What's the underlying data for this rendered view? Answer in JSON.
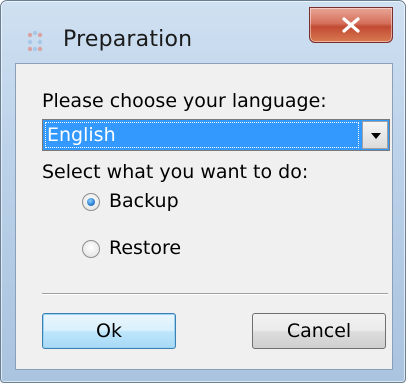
{
  "window": {
    "title": "Preparation",
    "close_icon": "close-icon",
    "app_icon": "app-recycle-icon"
  },
  "form": {
    "language_label": "Please choose your language:",
    "language_value": "English",
    "action_label": "Select what you want to do:",
    "options": [
      {
        "label": "Backup",
        "selected": true
      },
      {
        "label": "Restore",
        "selected": false
      }
    ]
  },
  "buttons": {
    "ok_label": "Ok",
    "cancel_label": "Cancel"
  },
  "colors": {
    "selection": "#3399ff",
    "close_button": "#c24a32"
  }
}
